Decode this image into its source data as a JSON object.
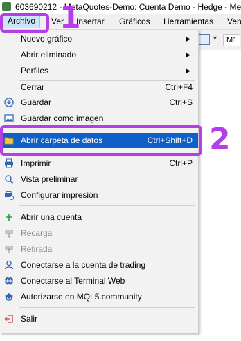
{
  "window": {
    "title": "603690212 - MetaQuotes-Demo: Cuenta Demo - Hedge - Me"
  },
  "menubar": {
    "items": [
      "Archivo",
      "Ver",
      "Insertar",
      "Gráficos",
      "Herramientas",
      "Ven"
    ]
  },
  "toolbar": {
    "timeframe": "M1"
  },
  "file_menu": {
    "items": [
      {
        "label": "Nuevo gráfico",
        "shortcut": "",
        "submenu": true,
        "icon": "none",
        "enabled": true
      },
      {
        "label": "Abrir eliminado",
        "shortcut": "",
        "submenu": true,
        "icon": "none",
        "enabled": true
      },
      {
        "label": "Perfiles",
        "shortcut": "",
        "submenu": true,
        "icon": "none",
        "enabled": true
      },
      {
        "label": "Cerrar",
        "shortcut": "Ctrl+F4",
        "submenu": false,
        "icon": "none",
        "enabled": true
      },
      {
        "label": "Guardar",
        "shortcut": "Ctrl+S",
        "submenu": false,
        "icon": "save-icon",
        "enabled": true
      },
      {
        "label": "Guardar como imagen",
        "shortcut": "",
        "submenu": false,
        "icon": "image-icon",
        "enabled": true
      },
      {
        "label": "Abrir carpeta de datos",
        "shortcut": "Ctrl+Shift+D",
        "submenu": false,
        "icon": "folder-icon",
        "enabled": true,
        "highlighted": true
      },
      {
        "label": "Imprimir",
        "shortcut": "Ctrl+P",
        "submenu": false,
        "icon": "printer-icon",
        "enabled": true
      },
      {
        "label": "Vista preliminar",
        "shortcut": "",
        "submenu": false,
        "icon": "print-preview-icon",
        "enabled": true
      },
      {
        "label": "Configurar impresión",
        "shortcut": "",
        "submenu": false,
        "icon": "print-setup-icon",
        "enabled": true
      },
      {
        "label": "Abrir una cuenta",
        "shortcut": "",
        "submenu": false,
        "icon": "plus-icon",
        "enabled": true
      },
      {
        "label": "Recarga",
        "shortcut": "",
        "submenu": false,
        "icon": "deposit-icon",
        "enabled": false
      },
      {
        "label": "Retirada",
        "shortcut": "",
        "submenu": false,
        "icon": "withdraw-icon",
        "enabled": false
      },
      {
        "label": "Conectarse a la cuenta de trading",
        "shortcut": "",
        "submenu": false,
        "icon": "user-icon",
        "enabled": true
      },
      {
        "label": "Conectarse al Terminal Web",
        "shortcut": "",
        "submenu": false,
        "icon": "globe-icon",
        "enabled": true
      },
      {
        "label": "Autorizarse en MQL5.community",
        "shortcut": "",
        "submenu": false,
        "icon": "mql5-hat-icon",
        "enabled": true
      },
      {
        "label": "Salir",
        "shortcut": "",
        "submenu": false,
        "icon": "exit-icon",
        "enabled": true
      }
    ]
  },
  "annotations": {
    "step1": "1",
    "step2": "2"
  },
  "colors": {
    "highlight": "#0f5fc7",
    "annotation": "#b53ee6",
    "menu_bg": "#f2f2f2"
  }
}
